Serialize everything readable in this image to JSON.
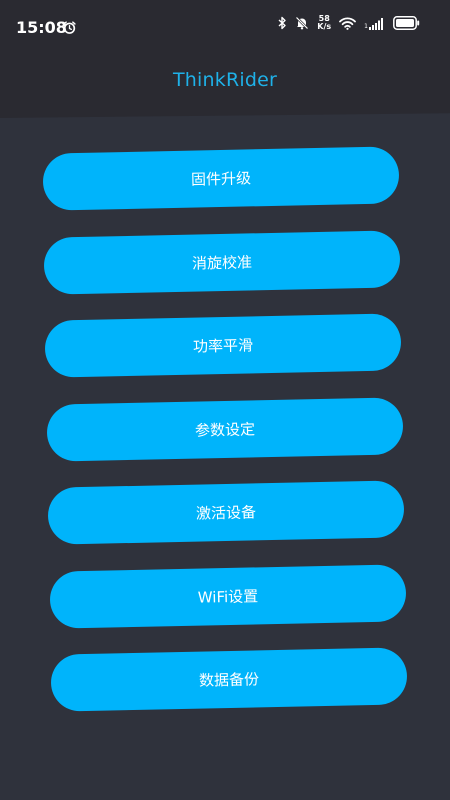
{
  "status_bar": {
    "time": "15:08",
    "net_speed_value": "58",
    "net_speed_unit": "K/s",
    "signal_sim_label": "1",
    "icons": [
      "alarm-icon",
      "bluetooth-icon",
      "muted-bell-icon",
      "wifi-icon",
      "signal-icon",
      "battery-icon"
    ]
  },
  "header": {
    "title": "ThinkRider"
  },
  "menu": {
    "items": [
      {
        "label": "固件升级"
      },
      {
        "label": "消旋校准"
      },
      {
        "label": "功率平滑"
      },
      {
        "label": "参数设定"
      },
      {
        "label": "激活设备"
      },
      {
        "label": "WiFi设置"
      },
      {
        "label": "数据备份"
      }
    ]
  },
  "colors": {
    "background": "#2f323c",
    "header_background": "#2a2a31",
    "title": "#1fb1e8",
    "button": "#00b4fb",
    "button_text": "#ffffff"
  }
}
